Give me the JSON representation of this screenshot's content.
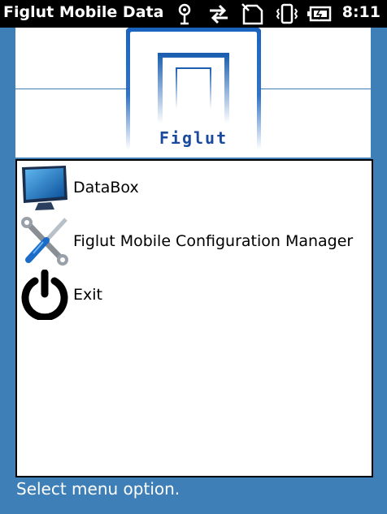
{
  "status_bar": {
    "app_title": "Figlut Mobile DataI",
    "time": "8:11",
    "icons": [
      "location-icon",
      "sync-arrows-icon",
      "no-sim-icon",
      "vibrate-icon",
      "battery-icon"
    ]
  },
  "banner": {
    "logo_text": "Figlut"
  },
  "menu": {
    "items": [
      {
        "label": "DataBox",
        "icon": "monitor-icon"
      },
      {
        "label": "Figlut Mobile Configuration Manager",
        "icon": "tools-icon"
      },
      {
        "label": "Exit",
        "icon": "power-icon"
      }
    ]
  },
  "footer": {
    "status": "Select menu option."
  },
  "colors": {
    "background": "#3d7fb6",
    "logo_blue": "#1a4a9e"
  }
}
